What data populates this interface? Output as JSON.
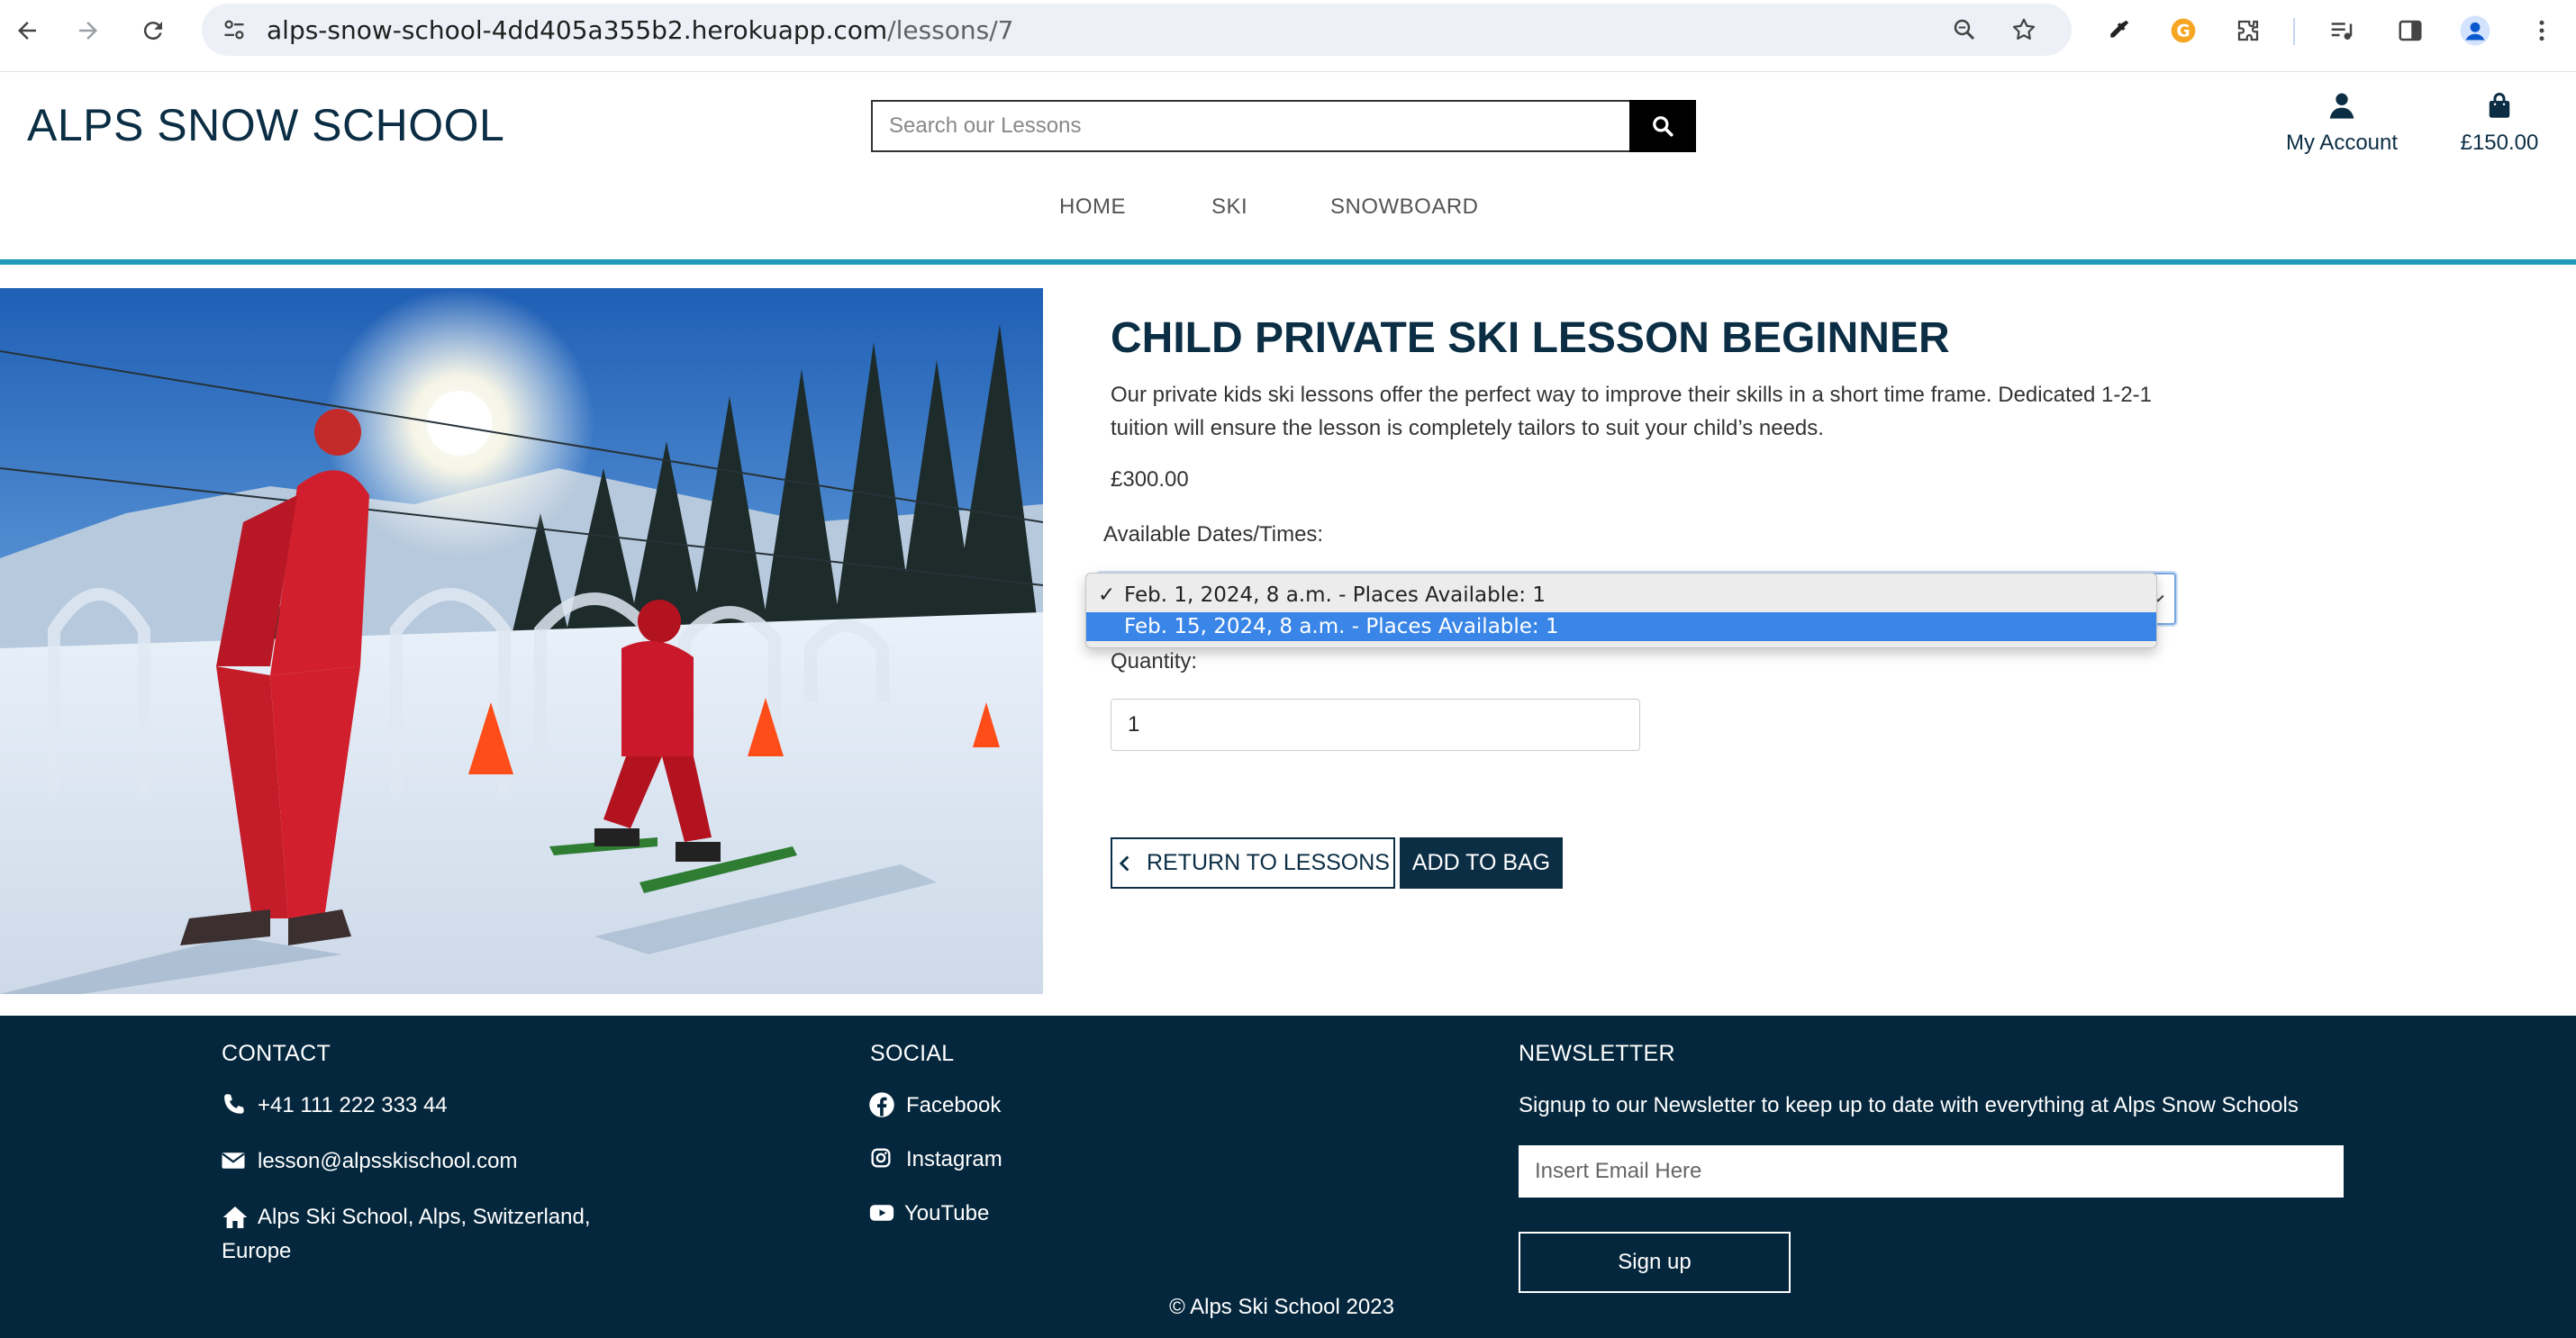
{
  "browser": {
    "url_host": "alps-snow-school-4dd405a355b2.herokuapp.com",
    "url_path": "/lessons/7"
  },
  "header": {
    "logo": "ALPS SNOW SCHOOL",
    "search_placeholder": "Search our Lessons",
    "account_label": "My Account",
    "bag_total": "£150.00"
  },
  "nav": {
    "items": [
      {
        "label": "HOME"
      },
      {
        "label": "SKI"
      },
      {
        "label": "SNOWBOARD"
      }
    ]
  },
  "product": {
    "title": "CHILD PRIVATE SKI LESSON BEGINNER",
    "description": "Our private kids ski lessons offer the perfect way to improve their skills in a short time frame. Dedicated 1-2-1 tuition will ensure the lesson is completely tailors to suit your child’s needs.",
    "price": "£300.00",
    "dates_label": "Available Dates/Times:",
    "date_options": [
      {
        "label": "Feb. 1, 2024, 8 a.m. - Places Available: 1",
        "selected": true,
        "highlighted": false
      },
      {
        "label": "Feb. 15, 2024, 8 a.m. - Places Available: 1",
        "selected": false,
        "highlighted": true
      }
    ],
    "quantity_label": "Quantity:",
    "quantity_value": "1",
    "return_label": "RETURN TO LESSONS",
    "add_label": "ADD TO BAG"
  },
  "footer": {
    "contact": {
      "heading": "CONTACT",
      "phone": "+41 111 222 333 44",
      "email": "lesson@alpsskischool.com",
      "address_line1": "Alps Ski School, Alps, Switzerland,",
      "address_line2": "Europe"
    },
    "social": {
      "heading": "SOCIAL",
      "links": [
        {
          "label": "Facebook",
          "icon": "facebook-icon"
        },
        {
          "label": "Instagram",
          "icon": "instagram-icon"
        },
        {
          "label": "YouTube",
          "icon": "youtube-icon"
        }
      ]
    },
    "newsletter": {
      "heading": "NEWSLETTER",
      "text": "Signup to our Newsletter to keep up to date with everything at Alps Snow Schools",
      "email_placeholder": "Insert Email Here",
      "button": "Sign up"
    },
    "copyright": "© Alps Ski School 2023"
  },
  "colors": {
    "brand_navy": "#0b2e45",
    "footer_bg": "#05273d",
    "accent_teal": "#1e9bb8",
    "option_highlight": "#3a86e8"
  }
}
